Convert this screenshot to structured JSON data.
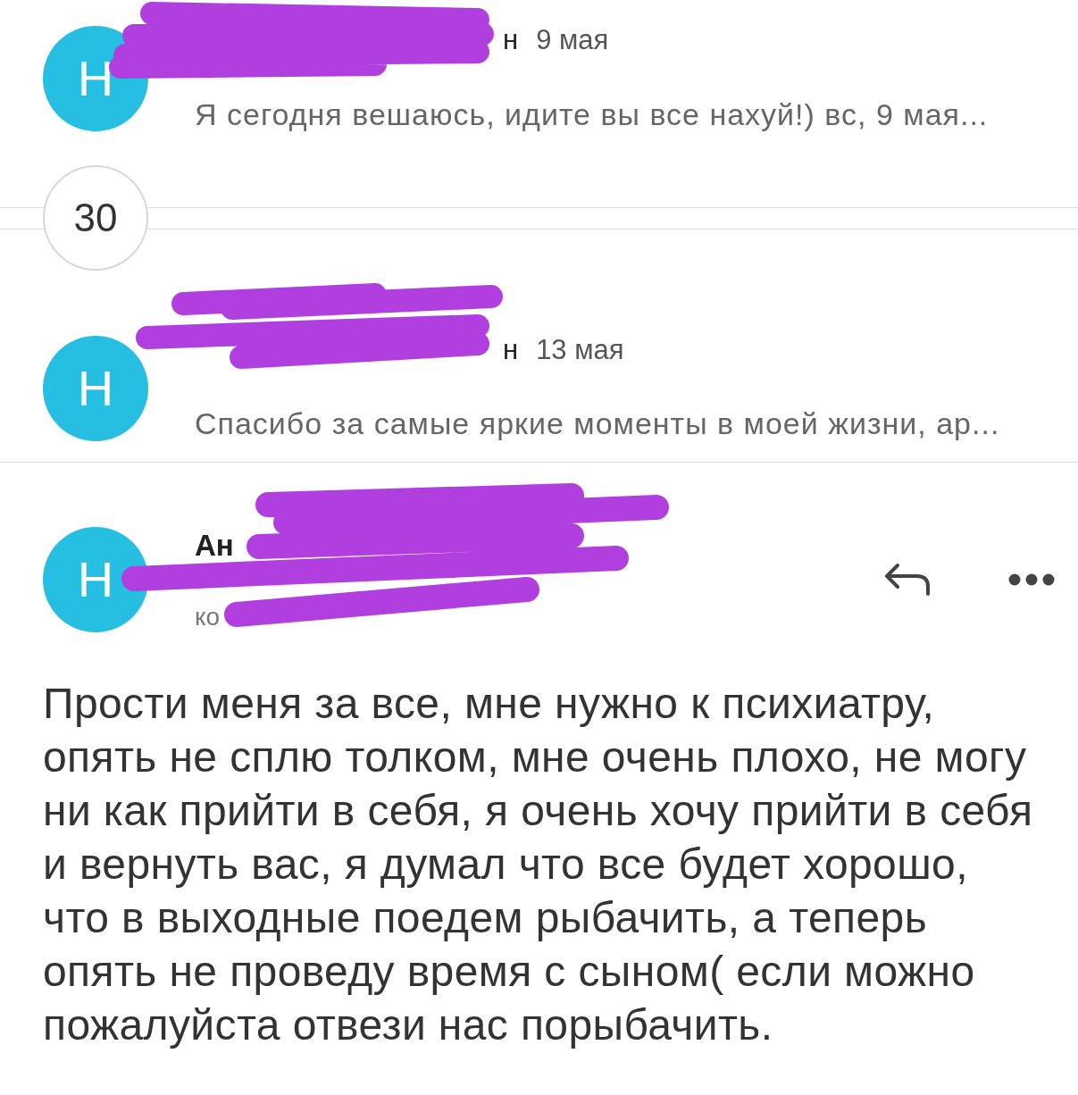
{
  "threads": [
    {
      "avatar": "H",
      "sender": "н",
      "date": "9 мая",
      "preview": "Я сегодня вешаюсь, идите вы все нахуй!) вс, 9 мая..."
    }
  ],
  "collapsed": {
    "count": "30"
  },
  "threads_after": [
    {
      "avatar": "H",
      "sender": "н",
      "date": "13 мая",
      "preview": "Спасибо за самые яркие моменты в моей жизни, ар..."
    }
  ],
  "open_message": {
    "avatar": "H",
    "sender": "Ан",
    "recipient": "ко",
    "body": "Прости меня за все, мне нужно к психиатру, опять не сплю толком, мне очень плохо, не могу ни как прийти в себя, я очень хочу прийти в себя и вернуть вас, я думал что все будет хорошо, что в выходные поедем рыбачить, а теперь опять не проведу время с сыном( если можно пожалуйста отвези нас порыбачить."
  }
}
